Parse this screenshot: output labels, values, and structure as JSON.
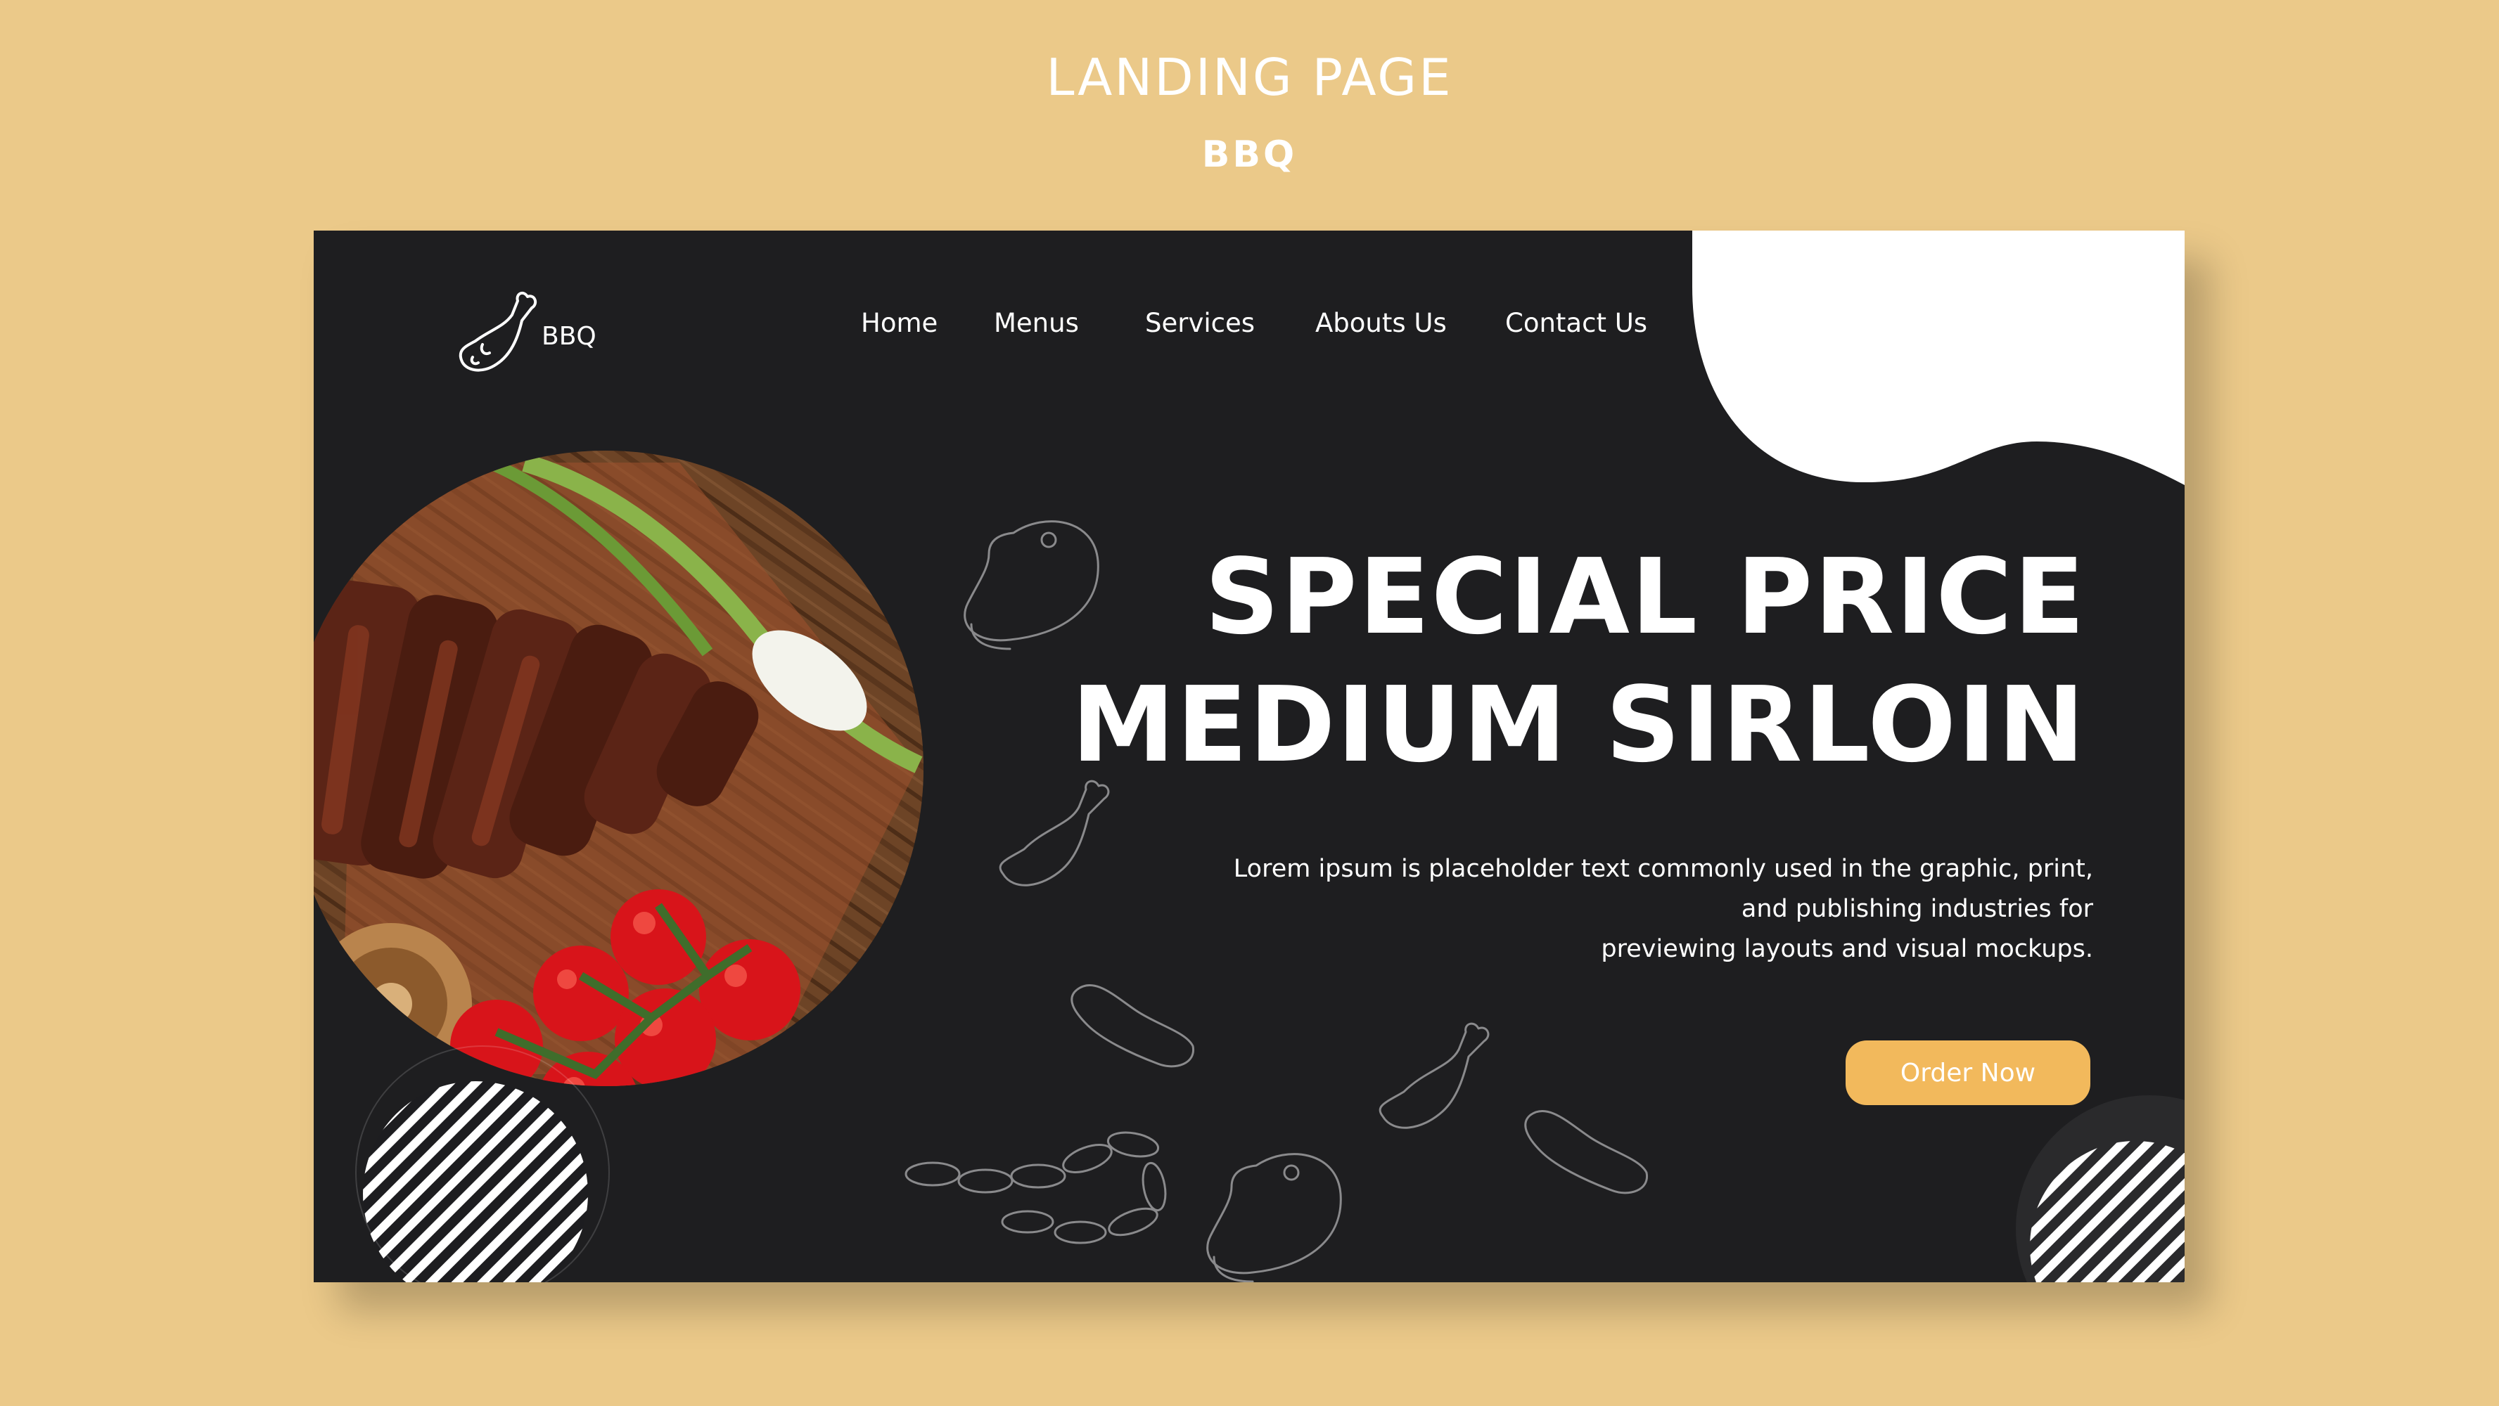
{
  "page": {
    "title": "LANDING PAGE",
    "subtitle": "BBQ"
  },
  "logo": {
    "icon": "drumstick-icon",
    "text": "BBQ"
  },
  "nav": {
    "items": [
      {
        "label": "Home"
      },
      {
        "label": "Menus"
      },
      {
        "label": "Services"
      },
      {
        "label": "Abouts Us"
      },
      {
        "label": "Contact Us"
      }
    ]
  },
  "hero": {
    "headline_line1": "SPECIAL PRICE",
    "headline_line2": "MEDIUM SIRLOIN",
    "body_line1": "Lorem ipsum is placeholder text commonly used in the graphic, print,",
    "body_line2": "and publishing industries for",
    "body_line3": "previewing layouts and visual mockups.",
    "cta_label": "Order Now"
  },
  "colors": {
    "background": "#EBC989",
    "panel": "#1E1E20",
    "accent": "#F2B95C",
    "text": "#FFFFFF"
  },
  "decorative_icons": [
    "steak-icon",
    "drumstick-icon",
    "sausage-icon",
    "sausage-chain-icon"
  ]
}
